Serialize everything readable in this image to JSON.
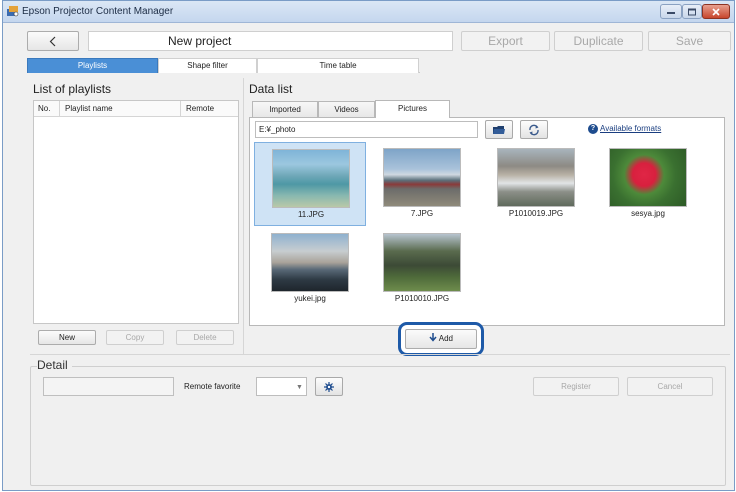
{
  "window": {
    "title": "Epson Projector Content Manager"
  },
  "toolbar": {
    "project_name": "New project",
    "export_label": "Export",
    "duplicate_label": "Duplicate",
    "save_label": "Save"
  },
  "tabs": [
    {
      "label": "Playlists",
      "active": true
    },
    {
      "label": "Shape filter",
      "active": false
    },
    {
      "label": "Time table",
      "active": false
    }
  ],
  "playlists": {
    "title": "List of playlists",
    "columns": [
      "No.",
      "Playlist name",
      "Remote"
    ],
    "new_label": "New",
    "copy_label": "Copy",
    "delete_label": "Delete"
  },
  "data_list": {
    "title": "Data list",
    "tabs": [
      "Imported",
      "Videos",
      "Pictures"
    ],
    "active_tab": "Pictures",
    "path": "E:¥_photo",
    "formats_link": "Available formats",
    "items": [
      {
        "name": "11.JPG",
        "selected": true
      },
      {
        "name": "7.JPG",
        "selected": false
      },
      {
        "name": "P1010019.JPG",
        "selected": false
      },
      {
        "name": "sesya.jpg",
        "selected": false
      },
      {
        "name": "yukei.jpg",
        "selected": false
      },
      {
        "name": "P1010010.JPG",
        "selected": false
      }
    ],
    "add_label": "Add"
  },
  "detail": {
    "title": "Detail",
    "remote_favorite_label": "Remote favorite",
    "register_label": "Register",
    "cancel_label": "Cancel"
  },
  "colors": {
    "accent": "#4a8fd6",
    "highlight_border": "#1e5aa8",
    "selected_bg": "#cfe3f5"
  }
}
